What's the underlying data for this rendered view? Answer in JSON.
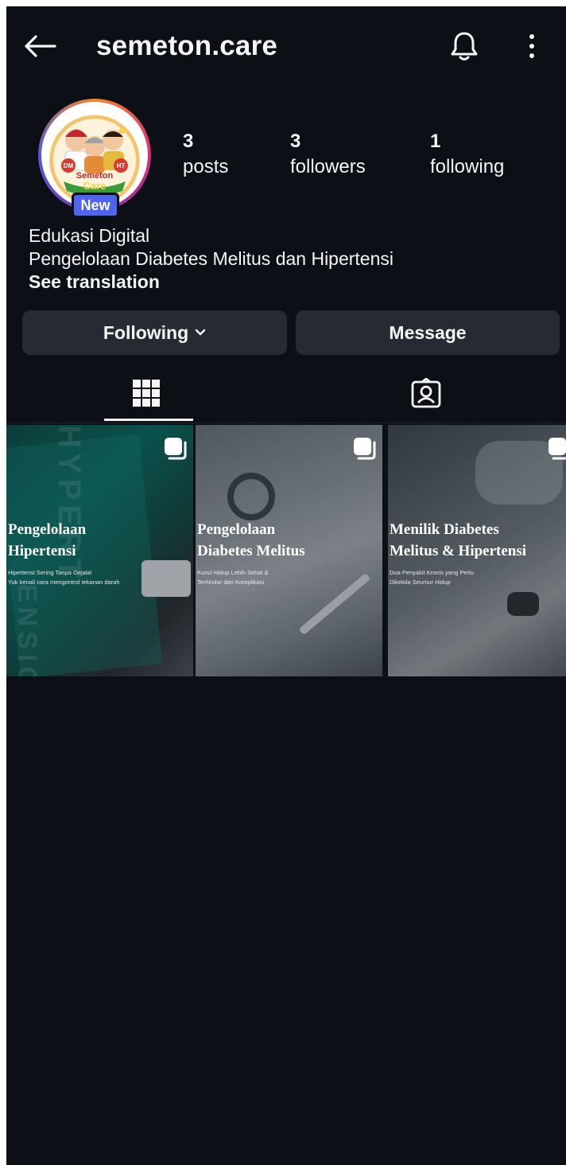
{
  "header": {
    "username": "semeton.care",
    "back_icon": "arrow-left-icon",
    "notification_icon": "bell-icon",
    "more_icon": "more-vertical-icon"
  },
  "profile": {
    "badge": "New",
    "stats": {
      "posts": {
        "count": "3",
        "label": "posts"
      },
      "followers": {
        "count": "3",
        "label": "followers"
      },
      "following": {
        "count": "1",
        "label": "following"
      }
    },
    "bio_lines": [
      "Edukasi Digital",
      "Pengelolaan Diabetes Melitus dan Hipertensi"
    ],
    "see_translation": "See translation",
    "avatar_text": [
      "DM",
      "HT",
      "Semeton",
      "Care"
    ]
  },
  "actions": {
    "following_label": "Following",
    "message_label": "Message"
  },
  "tabs": [
    {
      "icon": "grid-icon",
      "active": true
    },
    {
      "icon": "tagged-person-icon",
      "active": false
    }
  ],
  "posts": [
    {
      "title_lines": [
        "Pengelolaan",
        "Hipertensi"
      ],
      "subtitle_lines": [
        "Hipertensi Sering Tanpa Gejala!",
        "Yuk kenali cara mengontrol tekanan darah"
      ],
      "overlay_text": [
        "HYPERT",
        "ENSIO"
      ],
      "multi_icon": "carousel-icon"
    },
    {
      "title_lines": [
        "Pengelolaan",
        "Diabetes Melitus"
      ],
      "subtitle_lines": [
        "Kunci  Hidup  Lebih  Sehat  &",
        "Terhindar dari Komplikasi"
      ],
      "multi_icon": "carousel-icon"
    },
    {
      "title_lines": [
        "Menilik Diabetes",
        "Melitus & Hipertensi"
      ],
      "subtitle_lines": [
        "Dua Penyakit Kronis yang Perlu",
        "Dikelola Seumur Hidup"
      ],
      "multi_icon": "carousel-icon"
    }
  ],
  "colors": {
    "background": "#0c1016",
    "button": "#252a33",
    "badge": "#4f64f0",
    "text": "#f5f5f5"
  }
}
